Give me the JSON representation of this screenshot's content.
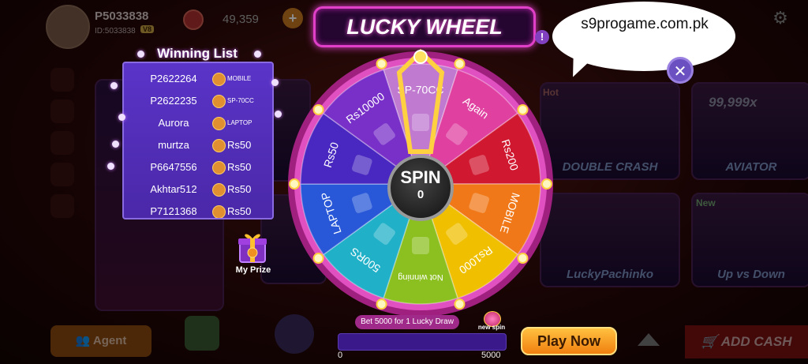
{
  "topbar": {
    "username": "P5033838",
    "user_id": "ID:5033838",
    "vip": "V8",
    "balance": "49,359"
  },
  "banner": {
    "url_text": "s9progame.com.pk"
  },
  "title": "LUCKY WHEEL",
  "winning_list": {
    "title": "Winning List",
    "rows": [
      {
        "name": "P2622264",
        "prize": "MOBILE"
      },
      {
        "name": "P2622235",
        "prize": "SP-70CC"
      },
      {
        "name": "Aurora",
        "prize": "LAPTOP"
      },
      {
        "name": "murtza",
        "prize": "Rs50"
      },
      {
        "name": "P6647556",
        "prize": "Rs50"
      },
      {
        "name": "Akhtar512",
        "prize": "Rs50"
      },
      {
        "name": "P7121368",
        "prize": "Rs50"
      }
    ]
  },
  "my_prize": {
    "label": "My Prize"
  },
  "wheel": {
    "segments": [
      {
        "label": "SP-70CC",
        "color": "#c07ad0"
      },
      {
        "label": "Again",
        "color": "#e040a0"
      },
      {
        "label": "Rs200",
        "color": "#d01830"
      },
      {
        "label": "MOBILE",
        "color": "#f07818"
      },
      {
        "label": "Rs1000",
        "color": "#f0c000"
      },
      {
        "label": "Not winning",
        "color": "#8cc020"
      },
      {
        "label": "500RS",
        "color": "#20b0c8"
      },
      {
        "label": "LAPTOP",
        "color": "#2858d8"
      },
      {
        "label": "Rs50",
        "color": "#4828c0"
      },
      {
        "label": "Rs10000",
        "color": "#7830c8"
      }
    ]
  },
  "spin": {
    "label": "SPIN",
    "count": "0"
  },
  "bet": {
    "text": "Bet 5000 for 1 Lucky Draw",
    "new_spin": "new spin"
  },
  "progress": {
    "min": "0",
    "max": "5000",
    "fraction": 0
  },
  "play_button": "Play Now",
  "background": {
    "agent": "Agent",
    "add_cash": "ADD CASH",
    "tiles": [
      "DOUBLE CRASH",
      "AVIATOR",
      "LuckyPachinko",
      "Up vs Down",
      "Hot",
      "New",
      "99,999x"
    ]
  }
}
